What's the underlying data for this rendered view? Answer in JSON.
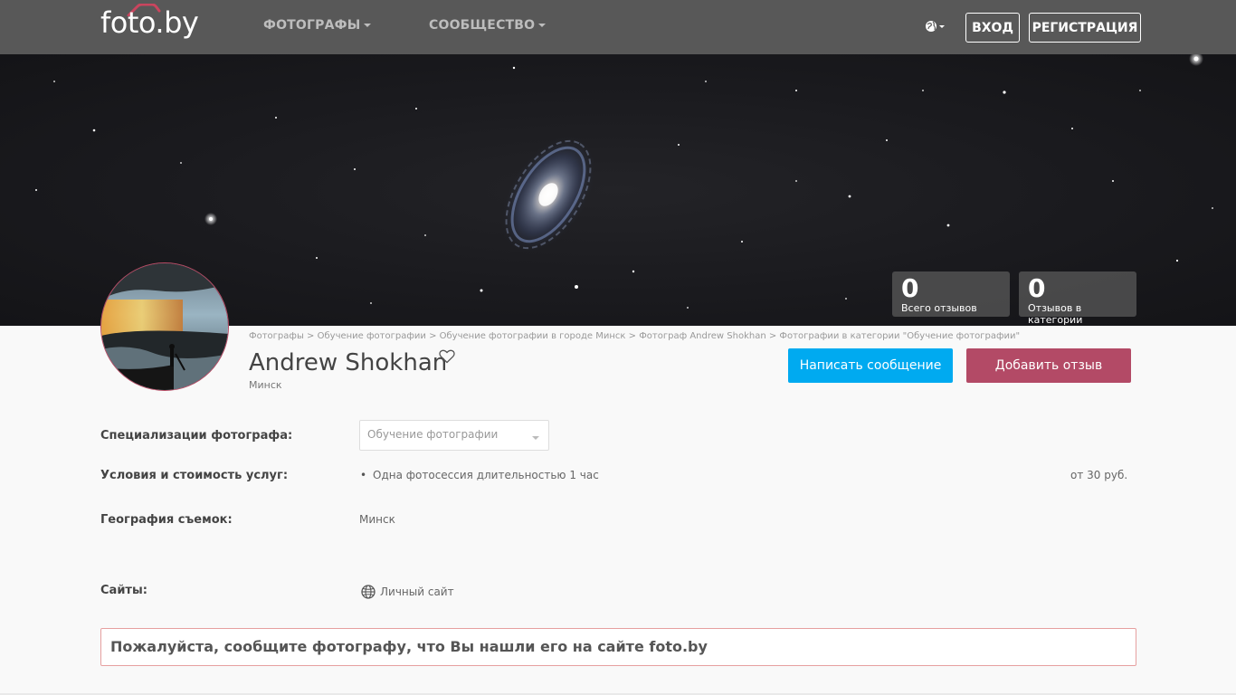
{
  "header": {
    "logo": "foto.by",
    "nav": [
      {
        "label": "ФОТОГРАФЫ"
      },
      {
        "label": "СООБЩЕСТВО"
      }
    ],
    "login_label": "ВХОД",
    "register_label": "РЕГИСТРАЦИЯ"
  },
  "stats": [
    {
      "value": "0",
      "label": "Всего отзывов"
    },
    {
      "value": "0",
      "label": "Отзывов в категории"
    }
  ],
  "breadcrumb": [
    "Фотографы",
    "Обучение фотографии",
    "Обучение фотографии в городе Минск",
    "Фотограф Andrew Shokhan",
    "Фотографии в категории \"Обучение фотографии\""
  ],
  "breadcrumb_separator": " > ",
  "profile": {
    "name": "Andrew Shokhan",
    "city": "Минск",
    "message_button": "Написать сообщение",
    "review_button": "Добавить отзыв"
  },
  "details": {
    "specializations_label": "Специализации фотографа:",
    "specialization_selected": "Обучение фотографии",
    "services_label": "Условия и стоимость услуг:",
    "service_bullet": "•",
    "service_name": "Одна фотосессия длительностью 1 час",
    "service_price": "от 30 руб.",
    "geography_label": "География съемок:",
    "geography_value": "Минск",
    "sites_label": "Сайты:",
    "site_link": "Личный сайт"
  },
  "notice": "Пожалуйста, сообщите фотографу, что Вы нашли его на сайте foto.by",
  "colors": {
    "header_bg": "#585858",
    "message_button": "#00aaf0",
    "review_button": "#b34a66",
    "notice_border": "#e6a0a0"
  }
}
